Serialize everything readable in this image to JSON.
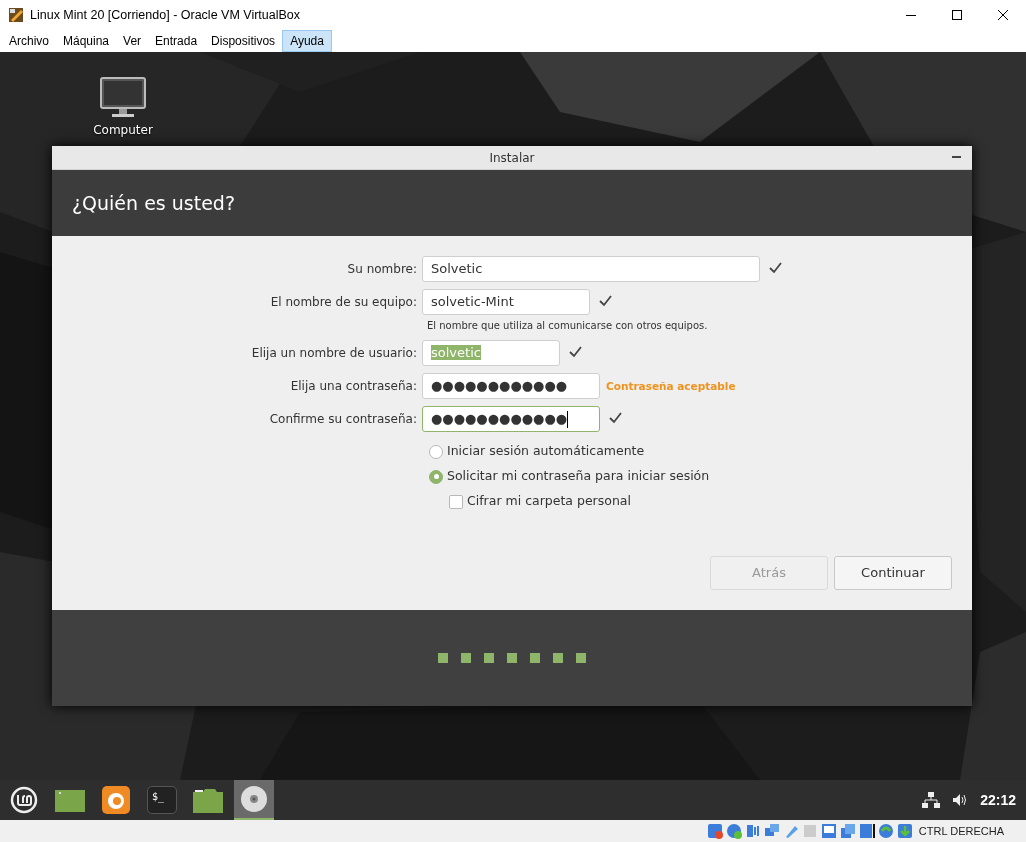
{
  "window": {
    "title": "Linux Mint 20 [Corriendo] - Oracle VM VirtualBox"
  },
  "menu": [
    {
      "label": "Archivo",
      "selected": false
    },
    {
      "label": "Máquina",
      "selected": false
    },
    {
      "label": "Ver",
      "selected": false
    },
    {
      "label": "Entrada",
      "selected": false
    },
    {
      "label": "Dispositivos",
      "selected": false
    },
    {
      "label": "Ayuda",
      "selected": true
    }
  ],
  "desktop_icons": [
    {
      "label": "Computer"
    }
  ],
  "installer": {
    "title": "Instalar",
    "heading": "¿Quién es usted?",
    "fields": [
      {
        "label": "Su nombre:",
        "value": "Solvetic",
        "valid": true,
        "focused": false,
        "text_selected": false
      },
      {
        "label": "El nombre de su equipo:",
        "value": "solvetic-Mint",
        "valid": true,
        "focused": false,
        "text_selected": false,
        "hint": "El nombre que utiliza al comunicarse con otros equipos."
      },
      {
        "label": "Elija un nombre de usuario:",
        "value": "solvetic",
        "valid": true,
        "focused": false,
        "text_selected": true
      },
      {
        "label": "Elija una contraseña:",
        "value": "●●●●●●●●●●●●",
        "valid": false,
        "focused": false,
        "text_selected": false,
        "status": "Contraseña aceptable"
      },
      {
        "label": "Confirme su contraseña:",
        "value": "●●●●●●●●●●●●",
        "valid": true,
        "focused": true,
        "text_selected": false
      }
    ],
    "options": [
      {
        "kind": "radio",
        "label": "Iniciar sesión automáticamente",
        "selected": false
      },
      {
        "kind": "radio",
        "label": "Solicitar mi contraseña para iniciar sesión",
        "selected": true,
        "children": [
          {
            "kind": "checkbox",
            "label": "Cifrar mi carpeta personal",
            "checked": false
          }
        ]
      }
    ],
    "buttons": [
      {
        "label": "Atrás",
        "disabled": true
      },
      {
        "label": "Continuar",
        "disabled": false
      }
    ],
    "steps": [
      {
        "done": true
      },
      {
        "done": true
      },
      {
        "done": true
      },
      {
        "done": true
      },
      {
        "done": true
      },
      {
        "done": true
      },
      {
        "done": true
      }
    ]
  },
  "taskbar": {
    "apps": [
      {
        "kind": "menu",
        "active": false
      },
      {
        "kind": "desktop",
        "active": false
      },
      {
        "kind": "browser",
        "active": false
      },
      {
        "kind": "terminal",
        "label": "$_",
        "active": false
      },
      {
        "kind": "files",
        "active": false
      },
      {
        "kind": "disc",
        "active": true
      }
    ],
    "clock": "22:12"
  },
  "status_bar": {
    "host_key": "CTRL DERECHA"
  }
}
